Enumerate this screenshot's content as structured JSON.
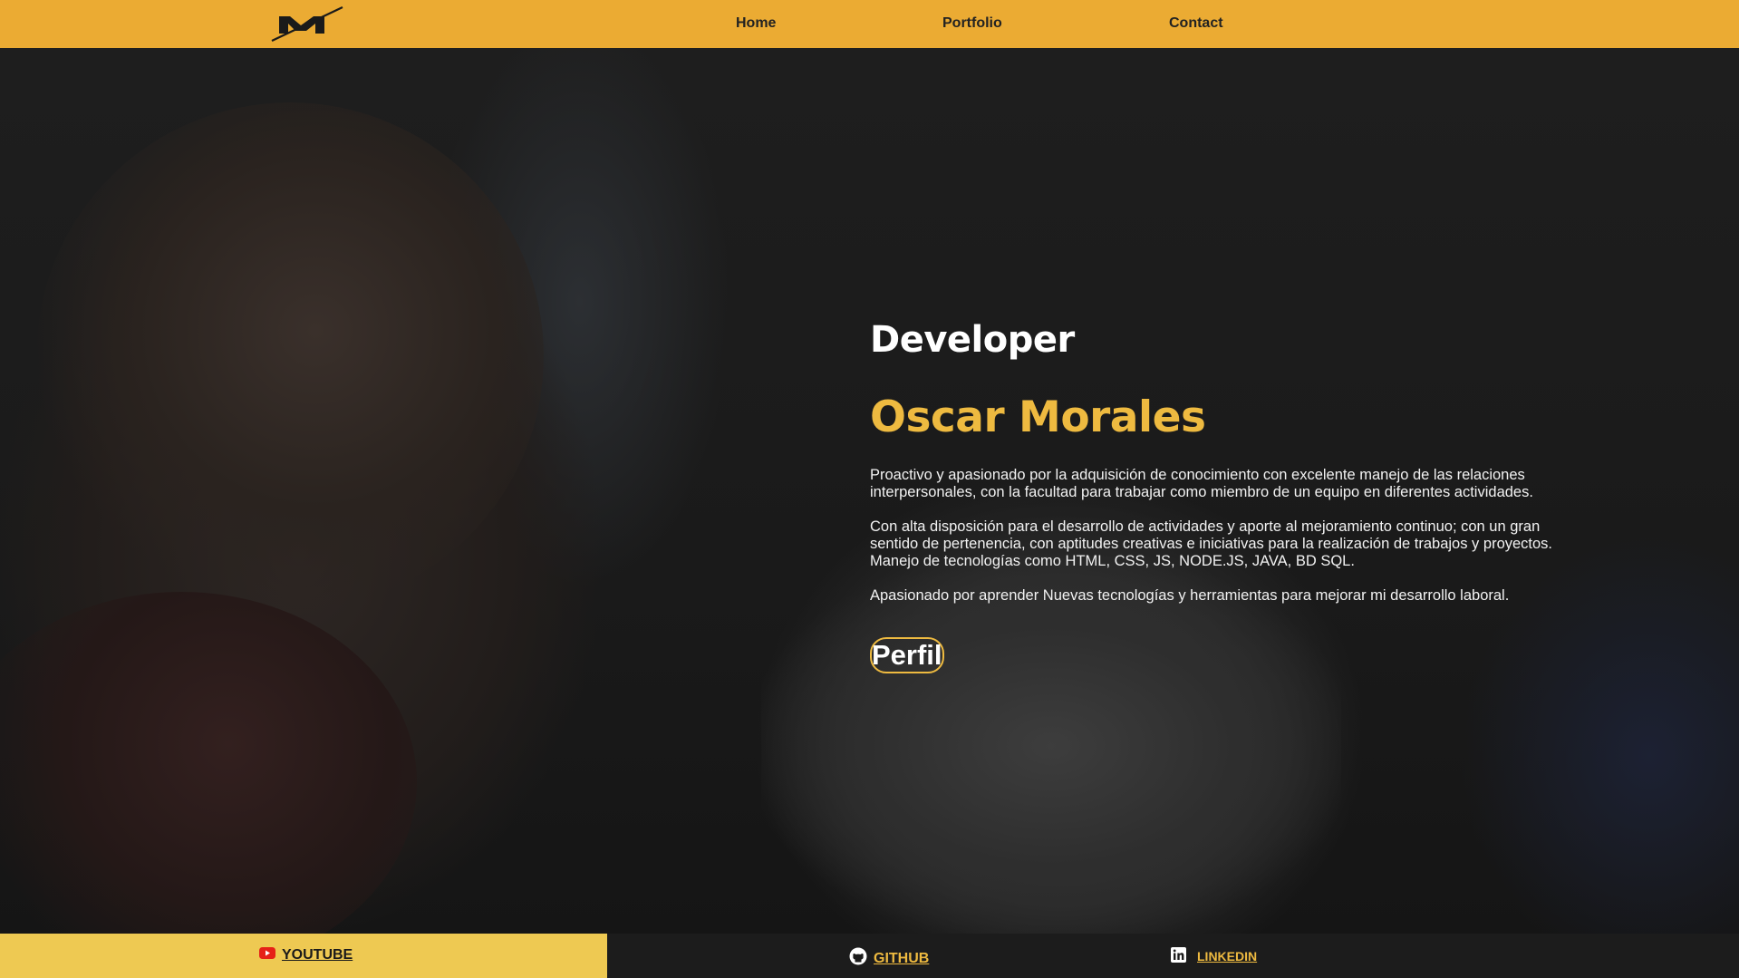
{
  "nav": {
    "logo_icon": "logo-m-icon",
    "items": [
      {
        "label": "Home"
      },
      {
        "label": "Portfolio"
      },
      {
        "label": "Contact"
      }
    ]
  },
  "hero": {
    "role": "Developer",
    "name": "Oscar Morales",
    "paragraphs": [
      "Proactivo y apasionado por la adquisición de conocimiento con excelente manejo de las relaciones interpersonales, con la facultad para trabajar como miembro de un equipo en diferentes actividades.",
      "Con alta disposición para el desarrollo de actividades y aporte al mejoramiento continuo; con un gran sentido de pertenencia, con aptitudes creativas e iniciativas para la realización de trabajos y proyectos. Manejo de tecnologías como HTML, CSS, JS, NODE.JS, JAVA, BD SQL.",
      "Apasionado por aprender Nuevas tecnologías y herramientas para mejorar mi desarrollo laboral."
    ],
    "button_label": "Perfil"
  },
  "footer": {
    "youtube": {
      "label": "YOUTUBE",
      "icon": "youtube-icon"
    },
    "github": {
      "label": "GITHUB",
      "icon": "github-icon"
    },
    "linkedin": {
      "label": "LINKEDIN",
      "icon": "linkedin-icon"
    }
  },
  "colors": {
    "header": "#ebab33",
    "accent": "#eeba40",
    "youtube_bg": "#eec952",
    "footer_bg": "#1c1c1c",
    "youtube_red": "#e62117",
    "link_gold": "#eeba40"
  }
}
